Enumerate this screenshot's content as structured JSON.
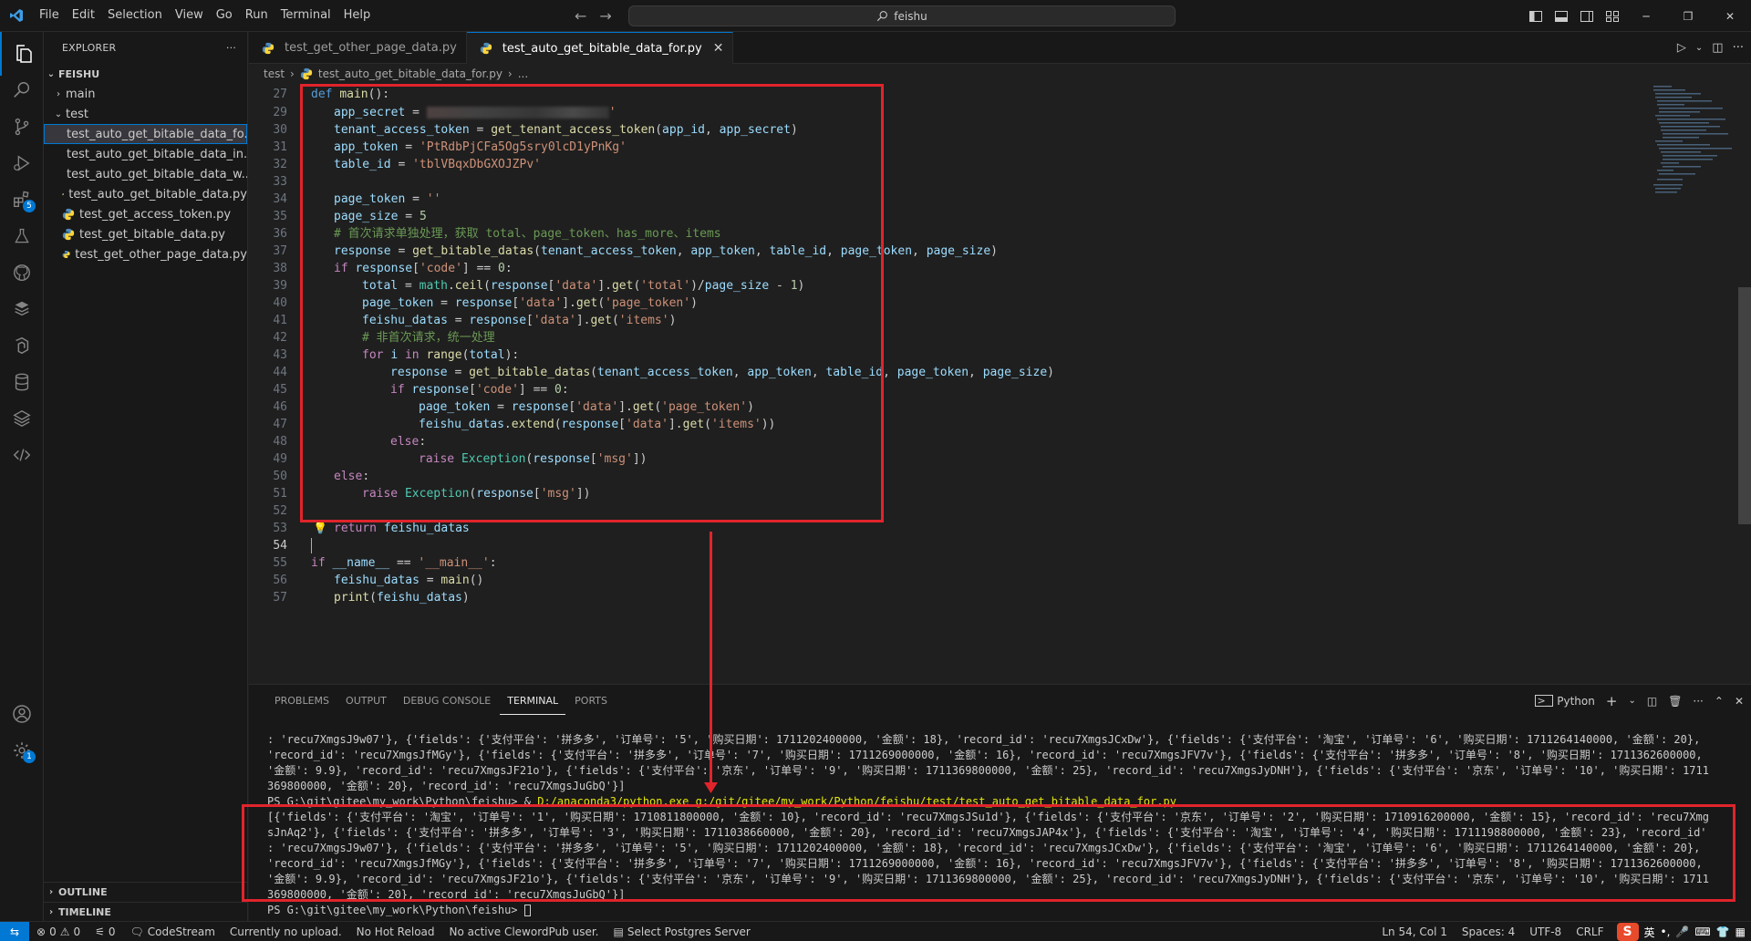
{
  "titlebar": {
    "menu": [
      "File",
      "Edit",
      "Selection",
      "View",
      "Go",
      "Run",
      "Terminal",
      "Help"
    ],
    "search": "feishu"
  },
  "activity": {
    "extensions_badge": "5",
    "settings_badge": "1"
  },
  "sidebar": {
    "title": "EXPLORER",
    "more": "···",
    "root": "FEISHU",
    "folders": [
      "main",
      "test"
    ],
    "files": [
      "test_auto_get_bitable_data_fo...",
      "test_auto_get_bitable_data_in...",
      "test_auto_get_bitable_data_w...",
      "test_auto_get_bitable_data.py",
      "test_get_access_token.py",
      "test_get_bitable_data.py",
      "test_get_other_page_data.py"
    ],
    "outline": "OUTLINE",
    "timeline": "TIMELINE"
  },
  "editor": {
    "tabs": [
      {
        "label": "test_get_other_page_data.py"
      },
      {
        "label": "test_auto_get_bitable_data_for.py"
      }
    ],
    "breadcrumb": {
      "folder": "test",
      "file": "test_auto_get_bitable_data_for.py",
      "tail": "..."
    },
    "line_numbers": [
      "27",
      "28",
      "29",
      "30",
      "31",
      "32",
      "33",
      "34",
      "35",
      "36",
      "37",
      "38",
      "39",
      "40",
      "41",
      "42",
      "43",
      "44",
      "45",
      "46",
      "47",
      "48",
      "49",
      "50",
      "51",
      "52",
      "53",
      "54",
      "55",
      "56",
      "57"
    ]
  },
  "panel": {
    "tabs": [
      "PROBLEMS",
      "OUTPUT",
      "DEBUG CONSOLE",
      "TERMINAL",
      "PORTS"
    ],
    "shell": "Python",
    "terminal_lines": [
      ": 'recu7XmgsJ9w07'}, {'fields': {'支付平台': '拼多多', '订单号': '5', '购买日期': 1711202400000, '金额': 18}, 'record_id': 'recu7XmgsJCxDw'}, {'fields': {'支付平台': '淘宝', '订单号': '6', '购买日期': 1711264140000, '金额': 20},",
      "'record_id': 'recu7XmgsJfMGy'}, {'fields': {'支付平台': '拼多多', '订单号': '7', '购买日期': 1711269000000, '金额': 16}, 'record_id': 'recu7XmgsJFV7v'}, {'fields': {'支付平台': '拼多多', '订单号': '8', '购买日期': 1711362600000,",
      "'金额': 9.9}, 'record_id': 'recu7XmgsJF21o'}, {'fields': {'支付平台': '京东', '订单号': '9', '购买日期': 1711369800000, '金额': 25}, 'record_id': 'recu7XmgsJyDNH'}, {'fields': {'支付平台': '京东', '订单号': '10', '购买日期': 1711",
      "369800000, '金额': 20}, 'record_id': 'recu7XmgsJuGbQ'}]"
    ],
    "prompt_line_prefix": "PS G:\\git\\gitee\\my_work\\Python\\feishu> & ",
    "prompt_line_cmd": "D:/anaconda3/python.exe g:/git/gitee/my_work/Python/feishu/test/test_auto_get_bitable_data_for.py",
    "output_lines": [
      "[{'fields': {'支付平台': '淘宝', '订单号': '1', '购买日期': 1710811800000, '金额': 10}, 'record_id': 'recu7XmgsJSu1d'}, {'fields': {'支付平台': '京东', '订单号': '2', '购买日期': 1710916200000, '金额': 15}, 'record_id': 'recu7Xmg",
      "sJnAq2'}, {'fields': {'支付平台': '拼多多', '订单号': '3', '购买日期': 1711038660000, '金额': 20}, 'record_id': 'recu7XmgsJAP4x'}, {'fields': {'支付平台': '淘宝', '订单号': '4', '购买日期': 1711198800000, '金额': 23}, 'record_id'",
      ": 'recu7XmgsJ9w07'}, {'fields': {'支付平台': '拼多多', '订单号': '5', '购买日期': 1711202400000, '金额': 18}, 'record_id': 'recu7XmgsJCxDw'}, {'fields': {'支付平台': '淘宝', '订单号': '6', '购买日期': 1711264140000, '金额': 20},",
      "'record_id': 'recu7XmgsJfMGy'}, {'fields': {'支付平台': '拼多多', '订单号': '7', '购买日期': 1711269000000, '金额': 16}, 'record_id': 'recu7XmgsJFV7v'}, {'fields': {'支付平台': '拼多多', '订单号': '8', '购买日期': 1711362600000,",
      "'金额': 9.9}, 'record_id': 'recu7XmgsJF21o'}, {'fields': {'支付平台': '京东', '订单号': '9', '购买日期': 1711369800000, '金额': 25}, 'record_id': 'recu7XmgsJyDNH'}, {'fields': {'支付平台': '京东', '订单号': '10', '购买日期': 1711",
      "369800000, '金额': 20}, 'record_id': 'recu7XmgsJuGbQ'}]"
    ],
    "final_prompt": "PS G:\\git\\gitee\\my_work\\Python\\feishu> "
  },
  "statusbar": {
    "errors": "0",
    "warnings": "0",
    "ports": "0",
    "items": [
      "CodeStream",
      "Currently no upload.",
      "No Hot Reload",
      "No active ClewordPub user.",
      "Select Postgres Server"
    ],
    "cursor": "Ln 54, Col 1",
    "spaces": "Spaces: 4",
    "encoding": "UTF-8",
    "eol": "CRLF",
    "ime_lang": "英"
  },
  "colors": {
    "accent": "#0078d4",
    "highlight_box": "#e0242b"
  }
}
